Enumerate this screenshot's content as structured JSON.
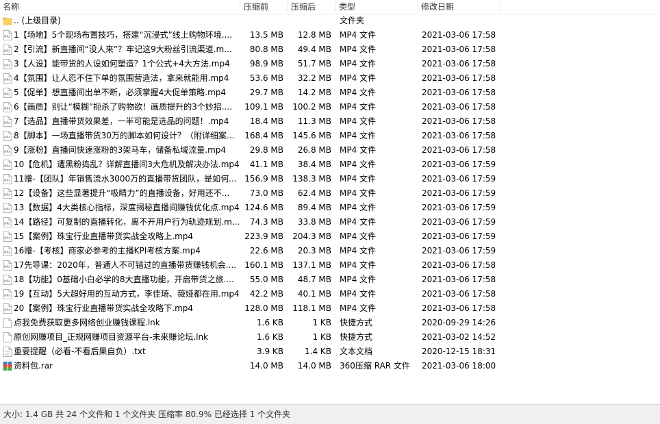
{
  "columns": {
    "name": "名称",
    "compressed": "压缩前",
    "original": "压缩后",
    "type": "类型",
    "modified": "修改日期"
  },
  "rows": [
    {
      "icon": "folder-icon",
      "name": ".. (上级目录)",
      "compressed": "",
      "original": "",
      "type": "文件夹",
      "date": ""
    },
    {
      "icon": "mp4-file-icon",
      "name": "1【场地】5个现场布置技巧，搭建“沉浸式”线上购物环境....",
      "compressed": "13.5 MB",
      "original": "12.8 MB",
      "type": "MP4 文件",
      "date": "2021-03-06 17:58"
    },
    {
      "icon": "mp4-file-icon",
      "name": "2【引流】新直播间“没人来”？牢记这9大粉丝引流渠道.m...",
      "compressed": "80.8 MB",
      "original": "49.4 MB",
      "type": "MP4 文件",
      "date": "2021-03-06 17:58"
    },
    {
      "icon": "mp4-file-icon",
      "name": "3【人设】能带货的人设如何塑造？1个公式+4大方法.mp4",
      "compressed": "98.9 MB",
      "original": "51.7 MB",
      "type": "MP4 文件",
      "date": "2021-03-06 17:58"
    },
    {
      "icon": "mp4-file-icon",
      "name": "4【氛围】让人忍不住下单的氛围营造法，拿来就能用.mp4",
      "compressed": "53.6 MB",
      "original": "32.2 MB",
      "type": "MP4 文件",
      "date": "2021-03-06 17:58"
    },
    {
      "icon": "mp4-file-icon",
      "name": "5【促单】想直播间出单不断，必须掌握4大促单策略.mp4",
      "compressed": "29.7 MB",
      "original": "14.2 MB",
      "type": "MP4 文件",
      "date": "2021-03-06 17:58"
    },
    {
      "icon": "mp4-file-icon",
      "name": "6【画质】别让“模糊”扼杀了购物欲！画质提升的3个妙招....",
      "compressed": "109.1 MB",
      "original": "100.2 MB",
      "type": "MP4 文件",
      "date": "2021-03-06 17:58"
    },
    {
      "icon": "mp4-file-icon",
      "name": "7【选品】直播带货效果差，一半可能是选品的问题！.mp4",
      "compressed": "18.4 MB",
      "original": "11.3 MB",
      "type": "MP4 文件",
      "date": "2021-03-06 17:58"
    },
    {
      "icon": "mp4-file-icon",
      "name": "8【脚本】一场直播带货30万的脚本如何设计？（附详细案...",
      "compressed": "168.4 MB",
      "original": "145.6 MB",
      "type": "MP4 文件",
      "date": "2021-03-06 17:58"
    },
    {
      "icon": "mp4-file-icon",
      "name": "9【涨粉】直播间快速涨粉的3架马车，储备私域流量.mp4",
      "compressed": "29.8 MB",
      "original": "26.8 MB",
      "type": "MP4 文件",
      "date": "2021-03-06 17:58"
    },
    {
      "icon": "mp4-file-icon",
      "name": "10【危机】遭黑粉捣乱？详解直播间3大危机及解决办法.mp4",
      "compressed": "41.1 MB",
      "original": "38.4 MB",
      "type": "MP4 文件",
      "date": "2021-03-06 17:59"
    },
    {
      "icon": "mp4-file-icon",
      "name": "11赠-【团队】年销售流水3000万的直播带货团队，是如何...",
      "compressed": "156.9 MB",
      "original": "138.3 MB",
      "type": "MP4 文件",
      "date": "2021-03-06 17:59"
    },
    {
      "icon": "mp4-file-icon",
      "name": "12【设备】这些显著提升“吸睛力”的直播设备，好用还不...",
      "compressed": "73.0 MB",
      "original": "62.4 MB",
      "type": "MP4 文件",
      "date": "2021-03-06 17:59"
    },
    {
      "icon": "mp4-file-icon",
      "name": "13【数据】4大类核心指标，深度揭秘直播间赚钱优化点.mp4",
      "compressed": "124.6 MB",
      "original": "89.4 MB",
      "type": "MP4 文件",
      "date": "2021-03-06 17:59"
    },
    {
      "icon": "mp4-file-icon",
      "name": "14【路径】可复制的直播转化，离不开用户行为轨迹规划.m...",
      "compressed": "74.3 MB",
      "original": "33.8 MB",
      "type": "MP4 文件",
      "date": "2021-03-06 17:59"
    },
    {
      "icon": "mp4-file-icon",
      "name": "15【案例】珠宝行业直播带货实战全攻略上.mp4",
      "compressed": "223.9 MB",
      "original": "204.3 MB",
      "type": "MP4 文件",
      "date": "2021-03-06 17:59"
    },
    {
      "icon": "mp4-file-icon",
      "name": "16赠-【考核】商家必参考的主播KPI考核方案.mp4",
      "compressed": "22.6 MB",
      "original": "20.3 MB",
      "type": "MP4 文件",
      "date": "2021-03-06 17:59"
    },
    {
      "icon": "mp4-file-icon",
      "name": "17先导课：2020年，普通人不可错过的直播带货赚钱机会....",
      "compressed": "160.1 MB",
      "original": "137.1 MB",
      "type": "MP4 文件",
      "date": "2021-03-06 17:58"
    },
    {
      "icon": "mp4-file-icon",
      "name": "18【功能】0基础小白必学的8大直播功能，开启带货之旅....",
      "compressed": "55.0 MB",
      "original": "48.7 MB",
      "type": "MP4 文件",
      "date": "2021-03-06 17:58"
    },
    {
      "icon": "mp4-file-icon",
      "name": "19【互动】5大超好用的互动方式，李佳琦、薇娅都在用.mp4",
      "compressed": "42.2 MB",
      "original": "40.1 MB",
      "type": "MP4 文件",
      "date": "2021-03-06 17:58"
    },
    {
      "icon": "mp4-file-icon",
      "name": "20【案例】珠宝行业直播带货实战全攻略下.mp4",
      "compressed": "128.0 MB",
      "original": "118.1 MB",
      "type": "MP4 文件",
      "date": "2021-03-06 17:58"
    },
    {
      "icon": "shortcut-file-icon",
      "name": "点我免费获取更多网络创业赚钱课程.lnk",
      "compressed": "1.6 KB",
      "original": "1 KB",
      "type": "快捷方式",
      "date": "2020-09-29 14:26"
    },
    {
      "icon": "shortcut-file-icon",
      "name": "原创网赚项目_正规网赚项目资源平台-未来赚论坛.lnk",
      "compressed": "1.6 KB",
      "original": "1 KB",
      "type": "快捷方式",
      "date": "2021-03-02 14:52"
    },
    {
      "icon": "text-file-icon",
      "name": "重要提醒（必看-不看后果自负）.txt",
      "compressed": "3.9 KB",
      "original": "1.4 KB",
      "type": "文本文档",
      "date": "2020-12-15 18:31"
    },
    {
      "icon": "rar-archive-icon",
      "name": "资料包.rar",
      "compressed": "14.0 MB",
      "original": "14.0 MB",
      "type": "360压缩 RAR 文件",
      "date": "2021-03-06 18:00"
    }
  ],
  "status": {
    "text": "大小: 1.4 GB 共 24 个文件和 1 个文件夹 压缩率 80.9% 已经选择 1 个文件夹"
  },
  "colors": {
    "folder": "#f5c542",
    "status_bg": "#f0f0f0"
  }
}
